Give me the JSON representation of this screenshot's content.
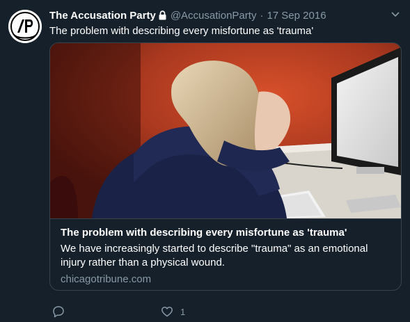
{
  "tweet": {
    "display_name": "The Accusation Party",
    "handle": "@AccusationParty",
    "separator": "·",
    "date": "17 Sep 2016",
    "text": "The problem with describing every misfortune as 'trauma'"
  },
  "card": {
    "title": "The problem with describing every misfortune as 'trauma'",
    "description": "We have increasingly started to describe \"trauma\" as an emotional injury rather than a physical wound.",
    "domain": "chicagotribune.com"
  },
  "actions": {
    "like_count": "1"
  },
  "icons": {
    "avatar": "avatar-logo-icon",
    "lock": "lock-icon",
    "caret": "chevron-down-icon",
    "reply": "reply-icon",
    "like": "heart-icon"
  },
  "colors": {
    "background": "#15202b",
    "border": "#38444d",
    "secondary_text": "#8899a6"
  }
}
